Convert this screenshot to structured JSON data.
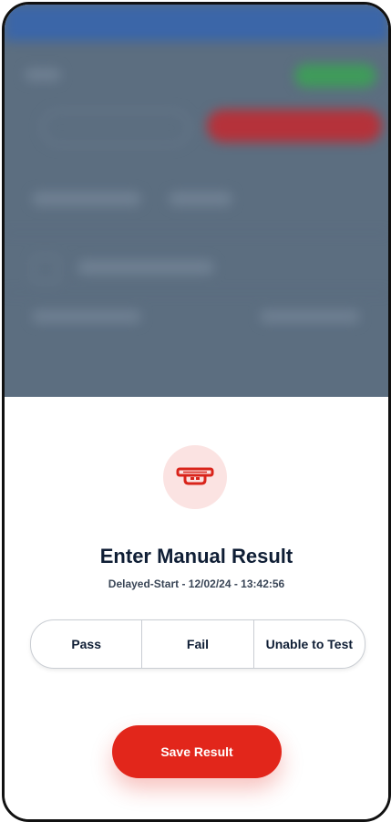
{
  "modal": {
    "icon_name": "smoke-detector-icon",
    "icon_color": "#d9241b",
    "icon_bg": "#fbe3e2",
    "title": "Enter Manual Result",
    "subtitle": "Delayed-Start - 12/02/24 - 13:42:56",
    "options": [
      {
        "label": "Pass",
        "name": "option-pass"
      },
      {
        "label": "Fail",
        "name": "option-fail"
      },
      {
        "label": "Unable to Test",
        "name": "option-unable-to-test"
      }
    ],
    "save_label": "Save Result",
    "accent": "#e2261b"
  }
}
